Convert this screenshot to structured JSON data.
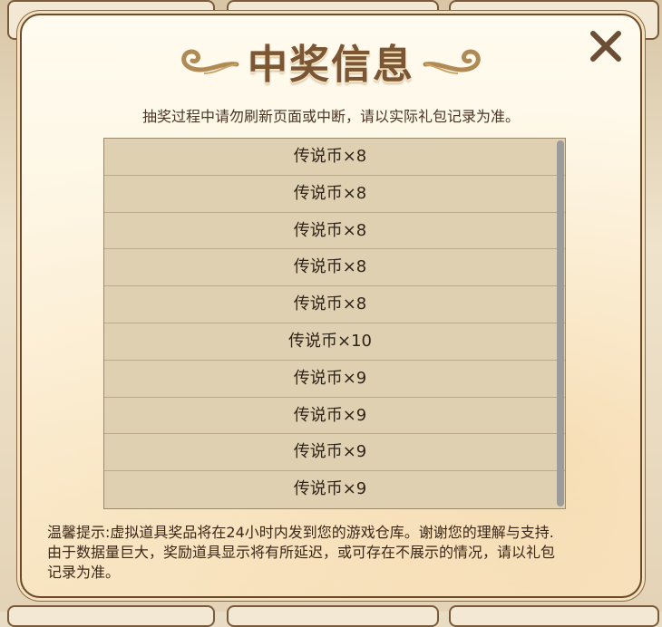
{
  "modal": {
    "title": "中奖信息",
    "notice": "抽奖过程中请勿刷新页面或中断，请以实际礼包记录为准。",
    "rewards": [
      "传说币×8",
      "传说币×8",
      "传说币×8",
      "传说币×8",
      "传说币×8",
      "传说币×10",
      "传说币×9",
      "传说币×9",
      "传说币×9",
      "传说币×9"
    ],
    "tip_lines": [
      "温馨提示:虚拟道具奖品将在24小时内发到您的游戏仓库。谢谢您的理解与支持.",
      "由于数据量巨大，奖励道具显示将有所延迟，或可存在不展示的情况，请以礼包",
      "记录为准。"
    ]
  },
  "colors": {
    "title": "#7a5634",
    "border": "#6b4a2a",
    "list_bg": "#dfd0b2",
    "text": "#2e2418"
  },
  "icons": {
    "close": "close-icon",
    "swirl_left": "left-swirl-ornament",
    "swirl_right": "right-swirl-ornament"
  }
}
